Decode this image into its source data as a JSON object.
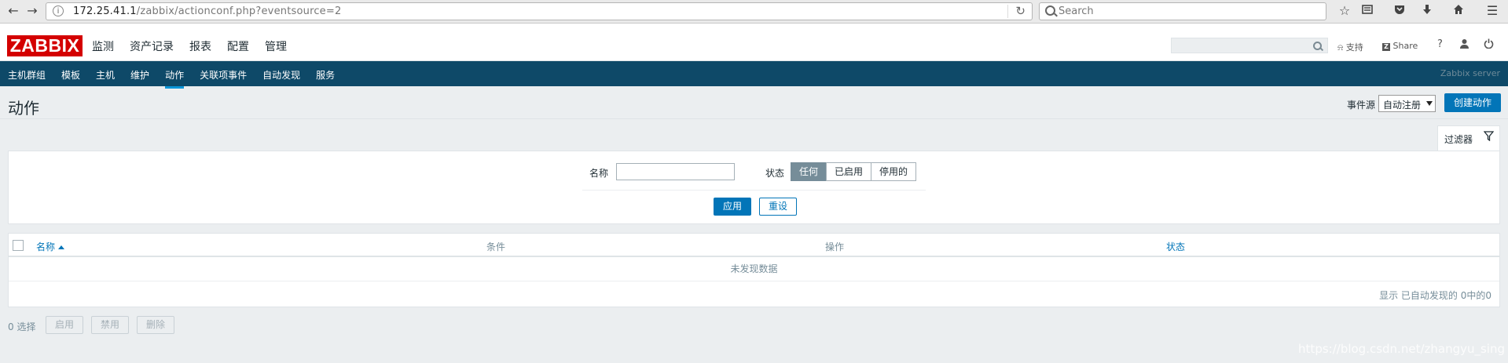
{
  "browser": {
    "url_host": "172.25.41.1",
    "url_path": "/zabbix/actionconf.php?eventsource=2",
    "search_placeholder": "Search"
  },
  "header": {
    "logo": "ZABBIX",
    "menu": [
      "监测",
      "资产记录",
      "报表",
      "配置",
      "管理"
    ],
    "active_menu": "配置",
    "support_label": "支持",
    "share_label": "Share",
    "help_label": "?"
  },
  "subnav": {
    "items": [
      "主机群组",
      "模板",
      "主机",
      "维护",
      "动作",
      "关联项事件",
      "自动发现",
      "服务"
    ],
    "active": "动作",
    "server_name": "Zabbix server"
  },
  "page": {
    "title": "动作",
    "event_source_label": "事件源",
    "event_source_value": "自动注册",
    "create_button": "创建动作"
  },
  "filter": {
    "tab_label": "过滤器",
    "name_label": "名称",
    "name_value": "",
    "status_label": "状态",
    "status_options": [
      "任何",
      "已启用",
      "停用的"
    ],
    "status_selected": "任何",
    "apply_button": "应用",
    "reset_button": "重设"
  },
  "table": {
    "columns": [
      "名称",
      "条件",
      "操作",
      "状态"
    ],
    "sorted_column": "名称",
    "sort_direction": "ascending",
    "no_data_text": "未发现数据",
    "paging_text": "显示 已自动发现的 0中的0"
  },
  "footer": {
    "selected_count": "0 选择",
    "buttons": [
      "启用",
      "禁用",
      "删除"
    ]
  },
  "watermark": "https://blog.csdn.net/zhangyu_sing",
  "colors": {
    "brand_red": "#d40000",
    "subnav_bg": "#0e4968",
    "accent_blue": "#0275b8",
    "selected_segment": "#768d99"
  }
}
